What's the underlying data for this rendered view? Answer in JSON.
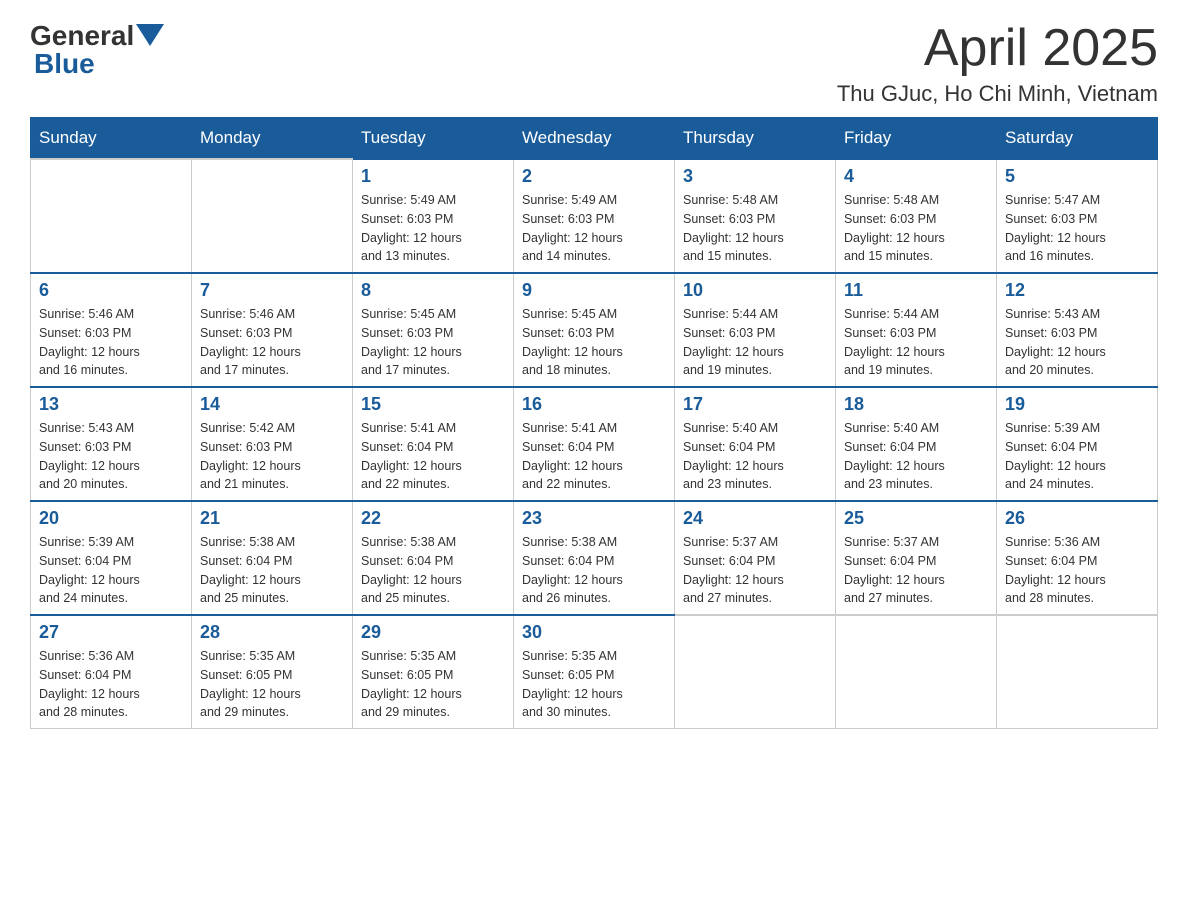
{
  "header": {
    "logo_general": "General",
    "logo_blue": "Blue",
    "month_title": "April 2025",
    "location": "Thu GJuc, Ho Chi Minh, Vietnam"
  },
  "days_of_week": [
    "Sunday",
    "Monday",
    "Tuesday",
    "Wednesday",
    "Thursday",
    "Friday",
    "Saturday"
  ],
  "weeks": [
    [
      {
        "day": "",
        "info": ""
      },
      {
        "day": "",
        "info": ""
      },
      {
        "day": "1",
        "info": "Sunrise: 5:49 AM\nSunset: 6:03 PM\nDaylight: 12 hours\nand 13 minutes."
      },
      {
        "day": "2",
        "info": "Sunrise: 5:49 AM\nSunset: 6:03 PM\nDaylight: 12 hours\nand 14 minutes."
      },
      {
        "day": "3",
        "info": "Sunrise: 5:48 AM\nSunset: 6:03 PM\nDaylight: 12 hours\nand 15 minutes."
      },
      {
        "day": "4",
        "info": "Sunrise: 5:48 AM\nSunset: 6:03 PM\nDaylight: 12 hours\nand 15 minutes."
      },
      {
        "day": "5",
        "info": "Sunrise: 5:47 AM\nSunset: 6:03 PM\nDaylight: 12 hours\nand 16 minutes."
      }
    ],
    [
      {
        "day": "6",
        "info": "Sunrise: 5:46 AM\nSunset: 6:03 PM\nDaylight: 12 hours\nand 16 minutes."
      },
      {
        "day": "7",
        "info": "Sunrise: 5:46 AM\nSunset: 6:03 PM\nDaylight: 12 hours\nand 17 minutes."
      },
      {
        "day": "8",
        "info": "Sunrise: 5:45 AM\nSunset: 6:03 PM\nDaylight: 12 hours\nand 17 minutes."
      },
      {
        "day": "9",
        "info": "Sunrise: 5:45 AM\nSunset: 6:03 PM\nDaylight: 12 hours\nand 18 minutes."
      },
      {
        "day": "10",
        "info": "Sunrise: 5:44 AM\nSunset: 6:03 PM\nDaylight: 12 hours\nand 19 minutes."
      },
      {
        "day": "11",
        "info": "Sunrise: 5:44 AM\nSunset: 6:03 PM\nDaylight: 12 hours\nand 19 minutes."
      },
      {
        "day": "12",
        "info": "Sunrise: 5:43 AM\nSunset: 6:03 PM\nDaylight: 12 hours\nand 20 minutes."
      }
    ],
    [
      {
        "day": "13",
        "info": "Sunrise: 5:43 AM\nSunset: 6:03 PM\nDaylight: 12 hours\nand 20 minutes."
      },
      {
        "day": "14",
        "info": "Sunrise: 5:42 AM\nSunset: 6:03 PM\nDaylight: 12 hours\nand 21 minutes."
      },
      {
        "day": "15",
        "info": "Sunrise: 5:41 AM\nSunset: 6:04 PM\nDaylight: 12 hours\nand 22 minutes."
      },
      {
        "day": "16",
        "info": "Sunrise: 5:41 AM\nSunset: 6:04 PM\nDaylight: 12 hours\nand 22 minutes."
      },
      {
        "day": "17",
        "info": "Sunrise: 5:40 AM\nSunset: 6:04 PM\nDaylight: 12 hours\nand 23 minutes."
      },
      {
        "day": "18",
        "info": "Sunrise: 5:40 AM\nSunset: 6:04 PM\nDaylight: 12 hours\nand 23 minutes."
      },
      {
        "day": "19",
        "info": "Sunrise: 5:39 AM\nSunset: 6:04 PM\nDaylight: 12 hours\nand 24 minutes."
      }
    ],
    [
      {
        "day": "20",
        "info": "Sunrise: 5:39 AM\nSunset: 6:04 PM\nDaylight: 12 hours\nand 24 minutes."
      },
      {
        "day": "21",
        "info": "Sunrise: 5:38 AM\nSunset: 6:04 PM\nDaylight: 12 hours\nand 25 minutes."
      },
      {
        "day": "22",
        "info": "Sunrise: 5:38 AM\nSunset: 6:04 PM\nDaylight: 12 hours\nand 25 minutes."
      },
      {
        "day": "23",
        "info": "Sunrise: 5:38 AM\nSunset: 6:04 PM\nDaylight: 12 hours\nand 26 minutes."
      },
      {
        "day": "24",
        "info": "Sunrise: 5:37 AM\nSunset: 6:04 PM\nDaylight: 12 hours\nand 27 minutes."
      },
      {
        "day": "25",
        "info": "Sunrise: 5:37 AM\nSunset: 6:04 PM\nDaylight: 12 hours\nand 27 minutes."
      },
      {
        "day": "26",
        "info": "Sunrise: 5:36 AM\nSunset: 6:04 PM\nDaylight: 12 hours\nand 28 minutes."
      }
    ],
    [
      {
        "day": "27",
        "info": "Sunrise: 5:36 AM\nSunset: 6:04 PM\nDaylight: 12 hours\nand 28 minutes."
      },
      {
        "day": "28",
        "info": "Sunrise: 5:35 AM\nSunset: 6:05 PM\nDaylight: 12 hours\nand 29 minutes."
      },
      {
        "day": "29",
        "info": "Sunrise: 5:35 AM\nSunset: 6:05 PM\nDaylight: 12 hours\nand 29 minutes."
      },
      {
        "day": "30",
        "info": "Sunrise: 5:35 AM\nSunset: 6:05 PM\nDaylight: 12 hours\nand 30 minutes."
      },
      {
        "day": "",
        "info": ""
      },
      {
        "day": "",
        "info": ""
      },
      {
        "day": "",
        "info": ""
      }
    ]
  ]
}
